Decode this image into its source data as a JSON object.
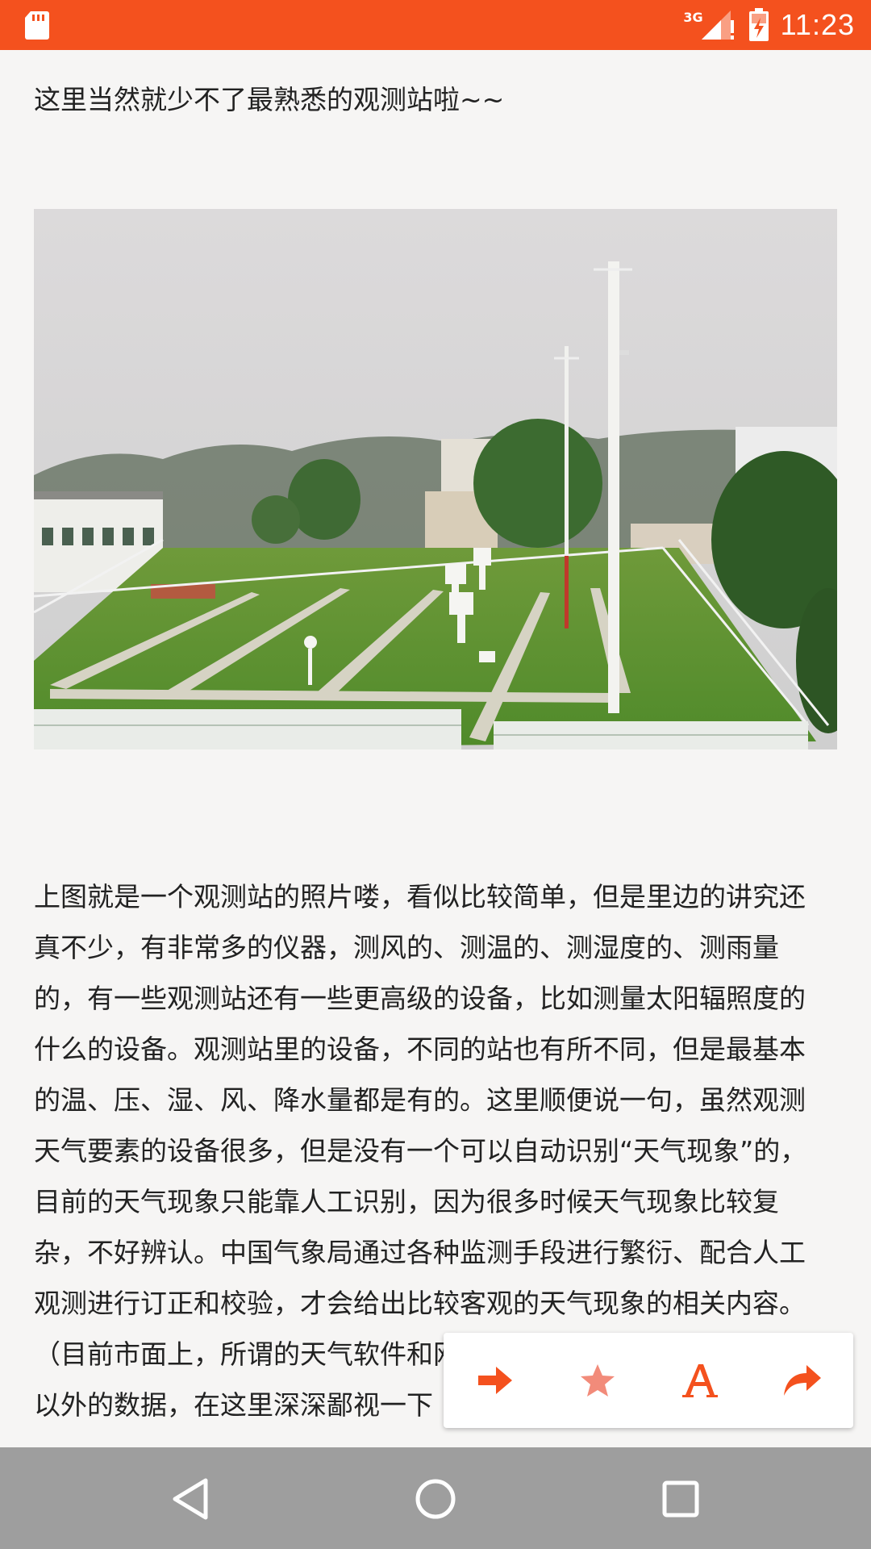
{
  "status_bar": {
    "time": "11:23",
    "network_label": "3G",
    "icons": [
      "sd-card-icon",
      "signal-icon",
      "battery-charging-icon"
    ],
    "background_color": "#f4511e"
  },
  "article": {
    "intro": "这里当然就少不了最熟悉的观测站啦~~",
    "image_alt": "weather-observation-station-photo",
    "body": "上图就是一个观测站的照片喽，看似比较简单，但是里边的讲究还真不少，有非常多的仪器，测风的、测温的、测湿度的、测雨量的，有一些观测站还有一些更高级的设备，比如测量太阳辐照度的什么的设备。观测站里的设备，不同的站也有所不同，但是最基本的温、压、湿、风、降水量都是有的。这里顺便说一句，虽然观测天气要素的设备很多，但是没有一个可以自动识别“天气现象”的，目前的天气现象只能靠人工识别，因为很多时候天气现象比较复杂，不好辨认。中国气象局通过各种监测手段进行繁衍、配合人工观测进行订正和校验，才会给出比较客观的天气现象的相关内容。（目前市面上，所谓的天气软件和网站很多都在使用一些气象部门以外的数据，在这里深深鄙视一下（呕吐状））"
  },
  "action_bar": {
    "items": [
      {
        "name": "next-arrow-icon",
        "glyph": "➔"
      },
      {
        "name": "star-icon",
        "glyph": "★"
      },
      {
        "name": "font-size-icon",
        "glyph": "A"
      },
      {
        "name": "share-icon",
        "glyph": "↪"
      }
    ],
    "accent_color": "#f4511e",
    "star_color": "#f28b7a"
  },
  "nav_bar": {
    "buttons": [
      "back-icon",
      "home-icon",
      "recents-icon"
    ],
    "background_color": "#9e9e9e"
  }
}
